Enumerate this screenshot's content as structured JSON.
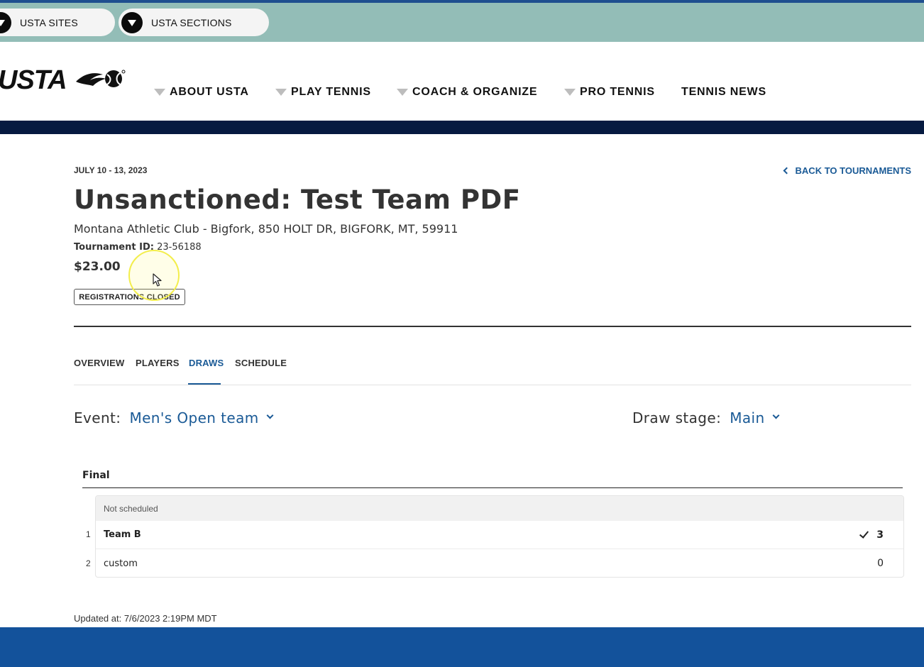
{
  "top_bar": {
    "sites_label": "USTA SITES",
    "sections_label": "USTA SECTIONS"
  },
  "header": {
    "logo_text": "USTA",
    "nav": [
      {
        "label": "ABOUT USTA",
        "has_dropdown": true
      },
      {
        "label": "PLAY TENNIS",
        "has_dropdown": true
      },
      {
        "label": "COACH & ORGANIZE",
        "has_dropdown": true
      },
      {
        "label": "PRO TENNIS",
        "has_dropdown": true
      },
      {
        "label": "TENNIS NEWS",
        "has_dropdown": false
      }
    ]
  },
  "tournament": {
    "date": "JULY 10 - 13, 2023",
    "back_link": "BACK TO TOURNAMENTS",
    "title": "Unsanctioned: Test Team PDF",
    "location": "Montana Athletic Club - Bigfork, 850 HOLT DR, BIGFORK, MT, 59911",
    "id_label": "Tournament ID:",
    "id_value": "23-56188",
    "price": "$23.00",
    "status_badge": "REGISTRATIONS CLOSED"
  },
  "tabs": [
    {
      "label": "OVERVIEW",
      "active": false
    },
    {
      "label": "PLAYERS",
      "active": false
    },
    {
      "label": "DRAWS",
      "active": true
    },
    {
      "label": "SCHEDULE",
      "active": false
    }
  ],
  "filters": {
    "event_label": "Event:",
    "event_value": "Men's Open team",
    "stage_label": "Draw stage:",
    "stage_value": "Main"
  },
  "draw": {
    "round_title": "Final",
    "match": {
      "status": "Not scheduled",
      "entries": [
        {
          "seed": "1",
          "name": "Team B",
          "score": "3",
          "winner": true
        },
        {
          "seed": "2",
          "name": "custom",
          "score": "0",
          "winner": false
        }
      ]
    }
  },
  "footer_note": {
    "updated": "Updated at: 7/6/2023 2:19PM MDT"
  },
  "colors": {
    "accent": "#1a5a96",
    "top_bar": "#93bdb7",
    "navy_band": "#061a40",
    "footer": "#13529b"
  }
}
